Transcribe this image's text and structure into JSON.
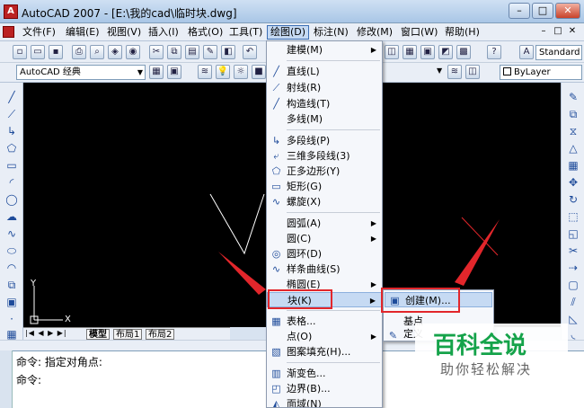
{
  "window": {
    "title": "AutoCAD 2007 - [E:\\我的cad\\临时块.dwg]",
    "app_icon": "A",
    "minimize": "–",
    "maximize": "□",
    "close": "✕"
  },
  "menubar": {
    "items": [
      {
        "label": "文件(F)"
      },
      {
        "label": "编辑(E)"
      },
      {
        "label": "视图(V)"
      },
      {
        "label": "插入(I)"
      },
      {
        "label": "格式(O)"
      },
      {
        "label": "工具(T)"
      },
      {
        "label": "绘图(D)"
      },
      {
        "label": "标注(N)"
      },
      {
        "label": "修改(M)"
      },
      {
        "label": "窗口(W)"
      },
      {
        "label": "帮助(H)"
      }
    ],
    "doc_controls": [
      "–",
      "□",
      "✕"
    ]
  },
  "toolbar2": {
    "workspace": "AutoCAD 经典",
    "text_style": "Standard",
    "linetype": "ByLayer"
  },
  "draw_menu": {
    "items": [
      {
        "label": "建模(M)",
        "icon": "none",
        "submenu": true
      },
      {
        "label": "直线(L)",
        "icon": "line-icon"
      },
      {
        "label": "射线(R)",
        "icon": "ray-icon"
      },
      {
        "label": "构造线(T)",
        "icon": "xline-icon"
      },
      {
        "label": "多线(M)",
        "icon": "none"
      },
      {
        "label": "多段线(P)",
        "icon": "polyline-icon"
      },
      {
        "label": "三维多段线(3)",
        "icon": "3dpolyline-icon"
      },
      {
        "label": "正多边形(Y)",
        "icon": "polygon-icon"
      },
      {
        "label": "矩形(G)",
        "icon": "rectangle-icon"
      },
      {
        "label": "螺旋(X)",
        "icon": "helix-icon"
      },
      {
        "label": "圆弧(A)",
        "icon": "none",
        "submenu": true
      },
      {
        "label": "圆(C)",
        "icon": "none",
        "submenu": true
      },
      {
        "label": "圆环(D)",
        "icon": "donut-icon"
      },
      {
        "label": "样条曲线(S)",
        "icon": "spline-icon"
      },
      {
        "label": "椭圆(E)",
        "icon": "none",
        "submenu": true
      },
      {
        "label": "块(K)",
        "icon": "none",
        "submenu": true
      },
      {
        "label": "表格...",
        "icon": "table-icon"
      },
      {
        "label": "点(O)",
        "icon": "none",
        "submenu": true
      },
      {
        "label": "图案填充(H)...",
        "icon": "hatch-icon"
      },
      {
        "label": "渐变色...",
        "icon": "gradient-icon"
      },
      {
        "label": "边界(B)...",
        "icon": "boundary-icon"
      },
      {
        "label": "面域(N)",
        "icon": "region-icon"
      }
    ]
  },
  "block_submenu": {
    "items": [
      {
        "label": "创建(M)...",
        "icon": "block-create-icon"
      },
      {
        "label": "基点",
        "icon": "none"
      },
      {
        "label": "定义",
        "icon": "attribute-icon"
      }
    ]
  },
  "layout_tabs": [
    "模型",
    "布局1",
    "布局2"
  ],
  "ucs": {
    "x": "X",
    "y": "Y"
  },
  "command": {
    "line1": "命令: 指定对角点:",
    "line2": "命令:"
  },
  "watermark": {
    "title": "百科全说",
    "subtitle": "助你轻松解决"
  },
  "colors": {
    "canvas": "#000000",
    "highlight_box": "#e2262b",
    "watermark_green": "#15a34a"
  }
}
